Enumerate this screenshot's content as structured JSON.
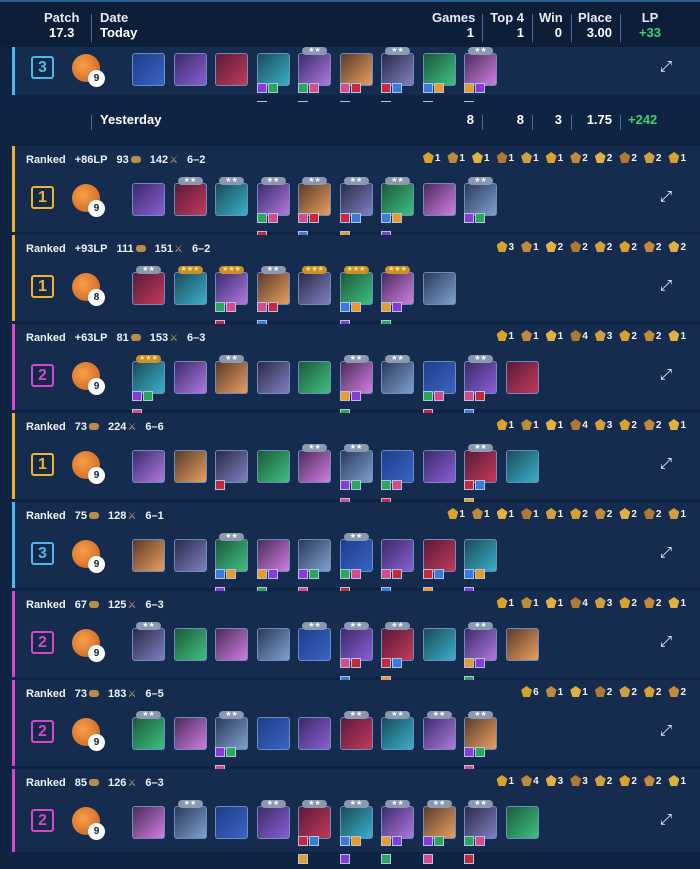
{
  "header": {
    "patch_label": "Patch",
    "patch_value": "17.3",
    "date_label": "Date",
    "date_value": "Today",
    "games_label": "Games",
    "games_value": "1",
    "top4_label": "Top 4",
    "top4_value": "1",
    "win_label": "Win",
    "win_value": "0",
    "place_label": "Place",
    "place_value": "3.00",
    "lp_label": "LP",
    "lp_value": "+33"
  },
  "yesterday": {
    "date": "Yesterday",
    "games": "8",
    "top4": "8",
    "win": "3",
    "place": "1.75",
    "lp": "+242"
  },
  "colors": {
    "place1": "#f0b429",
    "place2": "#d847c9",
    "place3": "#4fb8e8",
    "lp_positive": "#3ecf78",
    "header_bg": "#0c1e38",
    "row_bg": "#152c4e"
  },
  "matches": [
    {
      "mode": "",
      "lp": "",
      "gold": "",
      "damage": "",
      "stage": "",
      "place": "3",
      "level": "9",
      "units": [
        {
          "stars": 0,
          "items": 0
        },
        {
          "stars": 0,
          "items": 0
        },
        {
          "stars": 0,
          "items": 0
        },
        {
          "stars": 0,
          "items": 3
        },
        {
          "stars": 2,
          "items": 3
        },
        {
          "stars": 0,
          "items": 3
        },
        {
          "stars": 2,
          "items": 3
        },
        {
          "stars": 0,
          "items": 3
        },
        {
          "stars": 2,
          "items": 3
        }
      ],
      "traits": []
    },
    {
      "mode": "Ranked",
      "lp": "+86LP",
      "gold": "93",
      "damage": "142",
      "stage": "6–2",
      "place": "1",
      "level": "9",
      "units": [
        {
          "stars": 0,
          "items": 0
        },
        {
          "stars": 2,
          "items": 0
        },
        {
          "stars": 2,
          "items": 0
        },
        {
          "stars": 2,
          "items": 3
        },
        {
          "stars": 2,
          "items": 3
        },
        {
          "stars": 2,
          "items": 3
        },
        {
          "stars": 2,
          "items": 3
        },
        {
          "stars": 0,
          "items": 0
        },
        {
          "stars": 2,
          "items": 2
        }
      ],
      "traits": [
        "1",
        "1",
        "1",
        "1",
        "1",
        "1",
        "2",
        "2",
        "2",
        "2",
        "1"
      ]
    },
    {
      "mode": "Ranked",
      "lp": "+93LP",
      "gold": "111",
      "damage": "151",
      "stage": "6–2",
      "place": "1",
      "level": "8",
      "units": [
        {
          "stars": 2,
          "items": 0
        },
        {
          "stars": 3,
          "items": 0
        },
        {
          "stars": 3,
          "items": 3
        },
        {
          "stars": 2,
          "items": 3
        },
        {
          "stars": 3,
          "items": 0
        },
        {
          "stars": 3,
          "items": 3
        },
        {
          "stars": 3,
          "items": 3
        },
        {
          "stars": 0,
          "items": 0
        }
      ],
      "traits": [
        "3",
        "1",
        "2",
        "2",
        "2",
        "2",
        "2",
        "2"
      ]
    },
    {
      "mode": "Ranked",
      "lp": "+63LP",
      "gold": "81",
      "damage": "153",
      "stage": "6–3",
      "place": "2",
      "level": "9",
      "units": [
        {
          "stars": 3,
          "items": 3
        },
        {
          "stars": 0,
          "items": 0
        },
        {
          "stars": 2,
          "items": 0
        },
        {
          "stars": 0,
          "items": 0
        },
        {
          "stars": 0,
          "items": 0
        },
        {
          "stars": 2,
          "items": 3
        },
        {
          "stars": 2,
          "items": 0
        },
        {
          "stars": 0,
          "items": 3
        },
        {
          "stars": 2,
          "items": 3
        },
        {
          "stars": 0,
          "items": 0
        }
      ],
      "traits": [
        "1",
        "1",
        "1",
        "4",
        "3",
        "2",
        "2",
        "1"
      ]
    },
    {
      "mode": "Ranked",
      "lp": "",
      "gold": "73",
      "damage": "224",
      "stage": "6–6",
      "place": "1",
      "level": "9",
      "units": [
        {
          "stars": 0,
          "items": 0
        },
        {
          "stars": 0,
          "items": 0
        },
        {
          "stars": 0,
          "items": 1
        },
        {
          "stars": 0,
          "items": 0
        },
        {
          "stars": 2,
          "items": 0
        },
        {
          "stars": 2,
          "items": 3
        },
        {
          "stars": 0,
          "items": 3
        },
        {
          "stars": 0,
          "items": 0
        },
        {
          "stars": 2,
          "items": 3
        },
        {
          "stars": 0,
          "items": 0
        }
      ],
      "traits": [
        "1",
        "1",
        "1",
        "4",
        "3",
        "2",
        "2",
        "1"
      ]
    },
    {
      "mode": "Ranked",
      "lp": "",
      "gold": "75",
      "damage": "128",
      "stage": "6–1",
      "place": "3",
      "level": "9",
      "units": [
        {
          "stars": 0,
          "items": 0
        },
        {
          "stars": 0,
          "items": 0
        },
        {
          "stars": 2,
          "items": 3
        },
        {
          "stars": 0,
          "items": 3
        },
        {
          "stars": 0,
          "items": 3
        },
        {
          "stars": 2,
          "items": 3
        },
        {
          "stars": 0,
          "items": 3
        },
        {
          "stars": 0,
          "items": 3
        },
        {
          "stars": 0,
          "items": 3
        }
      ],
      "traits": [
        "1",
        "1",
        "1",
        "1",
        "1",
        "2",
        "2",
        "2",
        "2",
        "1"
      ]
    },
    {
      "mode": "Ranked",
      "lp": "",
      "gold": "67",
      "damage": "125",
      "stage": "6–3",
      "place": "2",
      "level": "9",
      "units": [
        {
          "stars": 2,
          "items": 0
        },
        {
          "stars": 0,
          "items": 0
        },
        {
          "stars": 0,
          "items": 0
        },
        {
          "stars": 0,
          "items": 0
        },
        {
          "stars": 2,
          "items": 0
        },
        {
          "stars": 2,
          "items": 3
        },
        {
          "stars": 2,
          "items": 3
        },
        {
          "stars": 0,
          "items": 0
        },
        {
          "stars": 2,
          "items": 3
        },
        {
          "stars": 0,
          "items": 0
        }
      ],
      "traits": [
        "1",
        "1",
        "1",
        "4",
        "3",
        "2",
        "2",
        "1"
      ]
    },
    {
      "mode": "Ranked",
      "lp": "",
      "gold": "73",
      "damage": "183",
      "stage": "6–5",
      "place": "2",
      "level": "9",
      "units": [
        {
          "stars": 2,
          "items": 0
        },
        {
          "stars": 0,
          "items": 0
        },
        {
          "stars": 2,
          "items": 3
        },
        {
          "stars": 0,
          "items": 0
        },
        {
          "stars": 0,
          "items": 0
        },
        {
          "stars": 2,
          "items": 0
        },
        {
          "stars": 2,
          "items": 0
        },
        {
          "stars": 2,
          "items": 0
        },
        {
          "stars": 2,
          "items": 3
        }
      ],
      "traits": [
        "6",
        "1",
        "1",
        "2",
        "2",
        "2",
        "2"
      ]
    },
    {
      "mode": "Ranked",
      "lp": "",
      "gold": "85",
      "damage": "126",
      "stage": "6–3",
      "place": "2",
      "level": "9",
      "units": [
        {
          "stars": 0,
          "items": 0
        },
        {
          "stars": 2,
          "items": 0
        },
        {
          "stars": 0,
          "items": 0
        },
        {
          "stars": 2,
          "items": 0
        },
        {
          "stars": 2,
          "items": 3
        },
        {
          "stars": 2,
          "items": 3
        },
        {
          "stars": 2,
          "items": 3
        },
        {
          "stars": 2,
          "items": 3
        },
        {
          "stars": 2,
          "items": 3
        },
        {
          "stars": 0,
          "items": 0
        }
      ],
      "traits": [
        "1",
        "4",
        "3",
        "3",
        "2",
        "2",
        "2",
        "1"
      ]
    }
  ]
}
